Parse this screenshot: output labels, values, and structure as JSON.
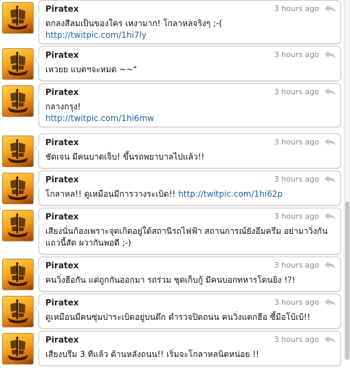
{
  "timeline": {
    "tweets": [
      {
        "author": "Piratex",
        "time": "3 hours ago",
        "text": "ตกลงสีลมเป็นของใคร เหงามาก! โกลาหลจริงๆ ;-(",
        "link": "http://twitpic.com/1hi7ly"
      },
      {
        "author": "Piratex",
        "time": "3 hours ago",
        "text": "เหวยย แบตฯจะหมด ~~\"",
        "link": ""
      },
      {
        "author": "Piratex",
        "time": "3 hours ago",
        "text": "กลางกรุง!",
        "link": "http://twitpic.com/1hi6mw"
      },
      {
        "author": "Piratex",
        "time": "3 hours ago",
        "text": "ชัดเจน มีคนบาดเจ็บ! ขึ้นรถพยาบาลไปแล้ว!!",
        "link": ""
      },
      {
        "author": "Piratex",
        "time": "3 hours ago",
        "text": "โกลาหล!! ดูเหมือนมีการวางระเบิด!!",
        "link": "http://twitpic.com/1hi62p"
      },
      {
        "author": "Piratex",
        "time": "3 hours ago",
        "text": "เสียงนั่นก้องเพราะจุดเกิดอยู่ใต้สถานีรถไฟฟ้า สถานการณ์ยังอึมครึม อย่ามาวิ่งกันแถวนี้สัด ผวากันพอดี ;-)",
        "link": ""
      },
      {
        "author": "Piratex",
        "time": "3 hours ago",
        "text": "คนวิ่งฮือกัน แต่ถูกกันออกมา รถร่วม ชุดเก็บกู้ มีคนบอกทหารโดนยิง !?!",
        "link": ""
      },
      {
        "author": "Piratex",
        "time": "3 hours ago",
        "text": "ดูเหมือนมีคนซุ่มปาระเบิดอยู่บนตึก ตำรวจปิดถนน คนวิ่งแตกฮือ ซี้มือโบ้เบ้!!",
        "link": ""
      },
      {
        "author": "Piratex",
        "time": "3 hours ago",
        "text": "เสียงบรึม 3 ทีแล้ว ด้านหลังถนน!! เริ่มจะโกลาหลนิดหน่อย !!",
        "link": ""
      }
    ]
  },
  "icons": {
    "avatar": "pirate-ship-icon",
    "reply": "reply-arrow-icon"
  },
  "colors": {
    "link": "#1f5fb0",
    "timestamp": "#888888",
    "bubble_border": "#c9c9c9"
  }
}
